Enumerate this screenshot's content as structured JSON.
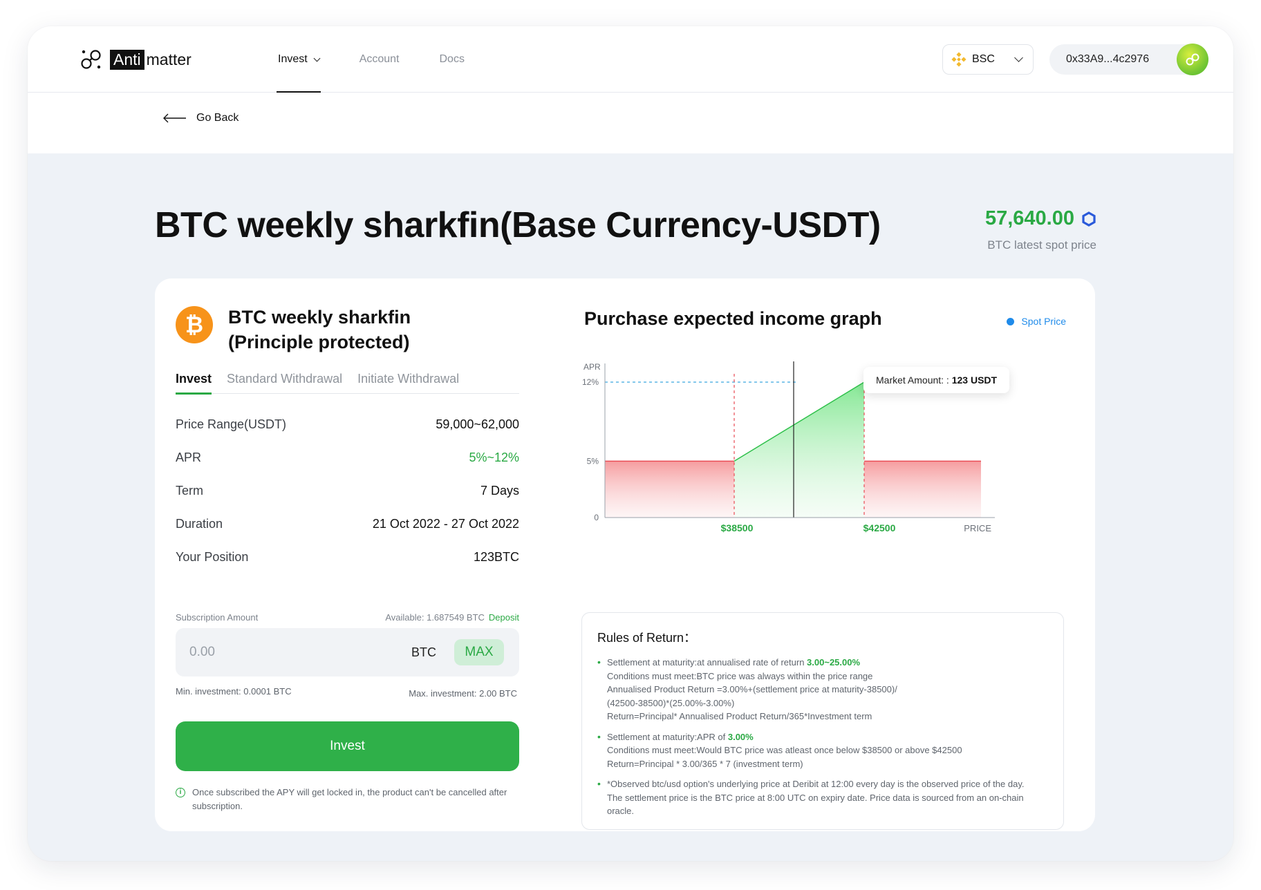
{
  "brand": {
    "anti": "Anti",
    "matter": "matter"
  },
  "nav": [
    {
      "label": "Invest"
    },
    {
      "label": "Account"
    },
    {
      "label": "Docs"
    }
  ],
  "chain": {
    "label": "BSC"
  },
  "wallet": {
    "address": "0x33A9...4c2976"
  },
  "go_back": "Go Back",
  "page": {
    "title": "BTC weekly sharkfin(Base Currency-USDT)",
    "spot_price": "57,640.00",
    "spot_label": "BTC latest spot price"
  },
  "product": {
    "title_line1": "BTC weekly sharkfin",
    "title_line2": "(Principle protected)",
    "coin_symbol": "₿"
  },
  "tabs": [
    {
      "label": "Invest",
      "active": true
    },
    {
      "label": "Standard Withdrawal",
      "active": false
    },
    {
      "label": "Initiate Withdrawal",
      "active": false
    }
  ],
  "info": [
    {
      "key": "Price Range(USDT)",
      "value": "59,000~62,000"
    },
    {
      "key": "APR",
      "value": "5%~12%"
    },
    {
      "key": "Term",
      "value": "7 Days"
    },
    {
      "key": "Duration",
      "value": "21 Oct 2022 - 27 Oct 2022"
    },
    {
      "key": "Your Position",
      "value": "123BTC"
    }
  ],
  "subscription": {
    "label": "Subscription Amount",
    "available": "Available: 1.687549 BTC",
    "deposit": "Deposit",
    "placeholder": "0.00",
    "unit": "BTC",
    "max": "MAX",
    "min": "Min. investment: 0.0001 BTC",
    "max_inv": "Max. investment: 2.00 BTC"
  },
  "invest_button": "Invest",
  "notice": "Once subscribed the APY will get locked in, the product can't be cancelled after subscription.",
  "graph": {
    "title": "Purchase expected income graph",
    "legend": "Spot Price",
    "tooltip_label": "Market Amount: :",
    "tooltip_value": "123 USDT"
  },
  "chart_data": {
    "type": "area",
    "ylabel": "APR",
    "xlabel": "PRICE",
    "y_ticks": [
      "0",
      "5%",
      "12%"
    ],
    "x_ticks": [
      "$38500",
      "$42500"
    ],
    "segments": [
      {
        "name": "below",
        "x": [
          0,
          38500
        ],
        "y": [
          5,
          5
        ],
        "color": "#f06a6a"
      },
      {
        "name": "within",
        "x": [
          38500,
          42500
        ],
        "y": [
          5,
          12
        ],
        "color": "#36c85a"
      },
      {
        "name": "above",
        "x": [
          42500,
          46000
        ],
        "y": [
          5,
          5
        ],
        "color": "#f06a6a"
      }
    ],
    "ylim": [
      0,
      12
    ],
    "spot_marker_x": 40400
  },
  "rules": {
    "title": "Rules of Return：",
    "items": [
      {
        "lead": "Settlement at maturity:at annualised rate of return ",
        "highlight": "3.00~25.00%",
        "lines": [
          "Conditions must meet:BTC price was always within the price range",
          "Annualised Product Return =3.00%+(settlement price at maturity-38500)/",
          "(42500-38500)*(25.00%-3.00%)",
          "Return=Principal* Annualised Product Return/365*Investment term"
        ]
      },
      {
        "lead": "Settlement at maturity:APR of ",
        "highlight": "3.00%",
        "lines": [
          "Conditions must meet:Would BTC price was atleast once below $38500 or above $42500",
          "Return=Principal * 3.00/365 * 7 (investment term)"
        ]
      },
      {
        "lead": "*Observed btc/usd option's underlying price at Deribit at 12:00 every day is the observed price of the day.",
        "highlight": "",
        "lines": [
          "The settlement price is the BTC price at 8:00 UTC on expiry date. Price data is sourced from an on-chain",
          "oracle."
        ]
      }
    ]
  }
}
